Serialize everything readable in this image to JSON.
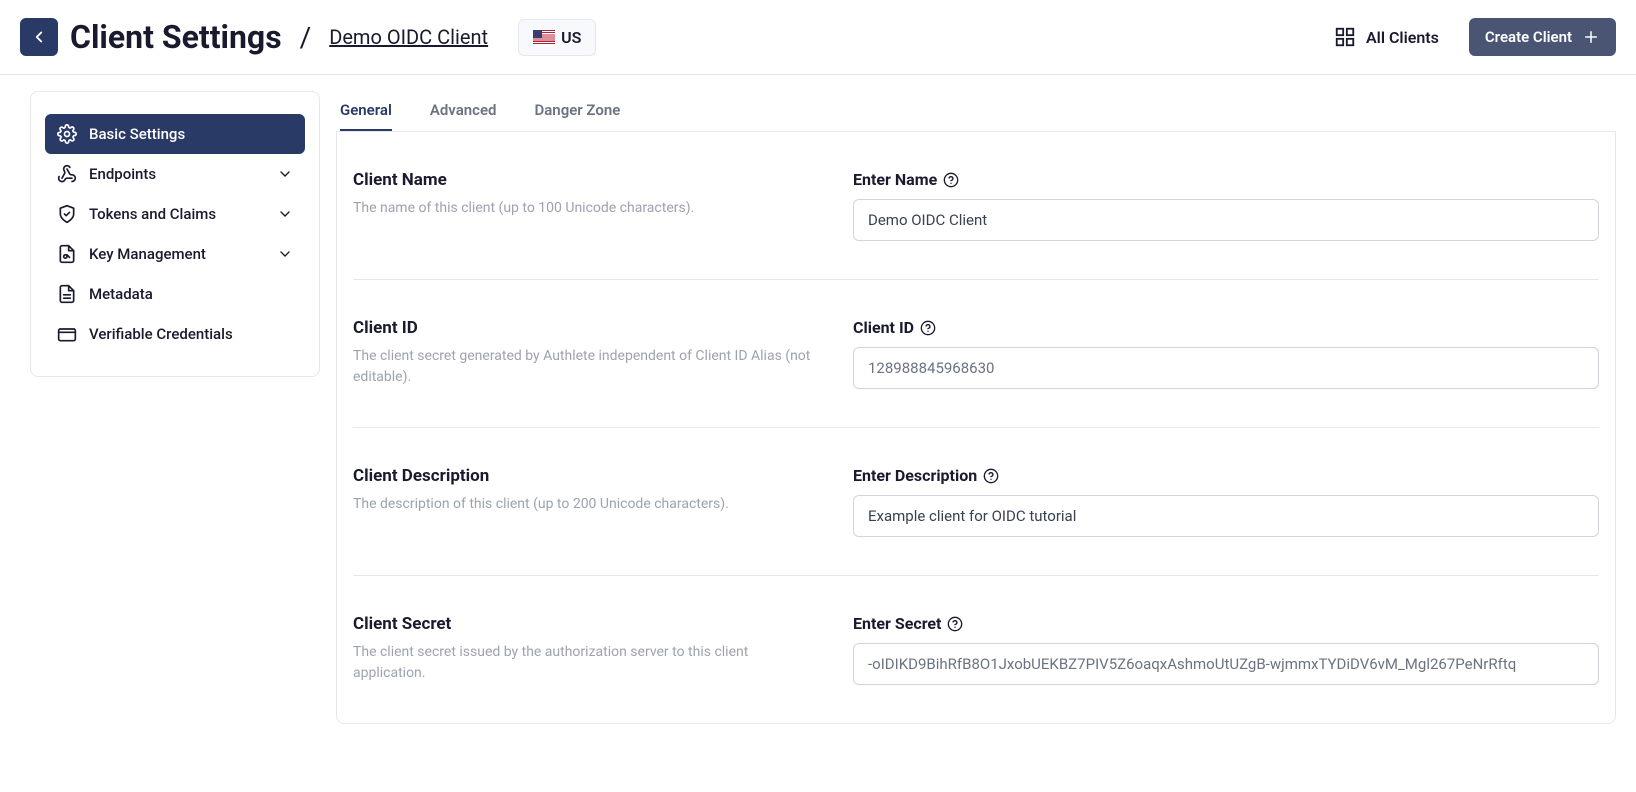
{
  "header": {
    "page_title": "Client Settings",
    "client_name_link": "Demo OIDC Client",
    "region_code": "US",
    "all_clients_label": "All Clients",
    "create_client_label": "Create Client"
  },
  "sidebar": {
    "items": [
      {
        "label": "Basic Settings",
        "active": true
      },
      {
        "label": "Endpoints",
        "expandable": true
      },
      {
        "label": "Tokens and Claims",
        "expandable": true
      },
      {
        "label": "Key Management",
        "expandable": true
      },
      {
        "label": "Metadata"
      },
      {
        "label": "Verifiable Credentials"
      }
    ]
  },
  "tabs": [
    {
      "label": "General",
      "active": true
    },
    {
      "label": "Advanced"
    },
    {
      "label": "Danger Zone"
    }
  ],
  "form": {
    "rows": [
      {
        "title": "Client Name",
        "desc": "The name of this client (up to 100 Unicode characters).",
        "field_label": "Enter Name",
        "value": "Demo OIDC Client",
        "readonly": false
      },
      {
        "title": "Client ID",
        "desc": "The client secret generated by Authlete independent of Client ID Alias (not editable).",
        "field_label": "Client ID",
        "value": "128988845968630",
        "readonly": true
      },
      {
        "title": "Client Description",
        "desc": "The description of this client (up to 200 Unicode characters).",
        "field_label": "Enter Description",
        "value": "Example client for OIDC tutorial",
        "readonly": false
      },
      {
        "title": "Client Secret",
        "desc": "The client secret issued by the authorization server to this client application.",
        "field_label": "Enter Secret",
        "value": "-oIDIKD9BihRfB8O1JxobUEKBZ7PIV5Z6oaqxAshmoUtUZgB-wjmmxTYDiDV6vM_Mgl267PeNrRftq",
        "readonly": true
      }
    ]
  }
}
